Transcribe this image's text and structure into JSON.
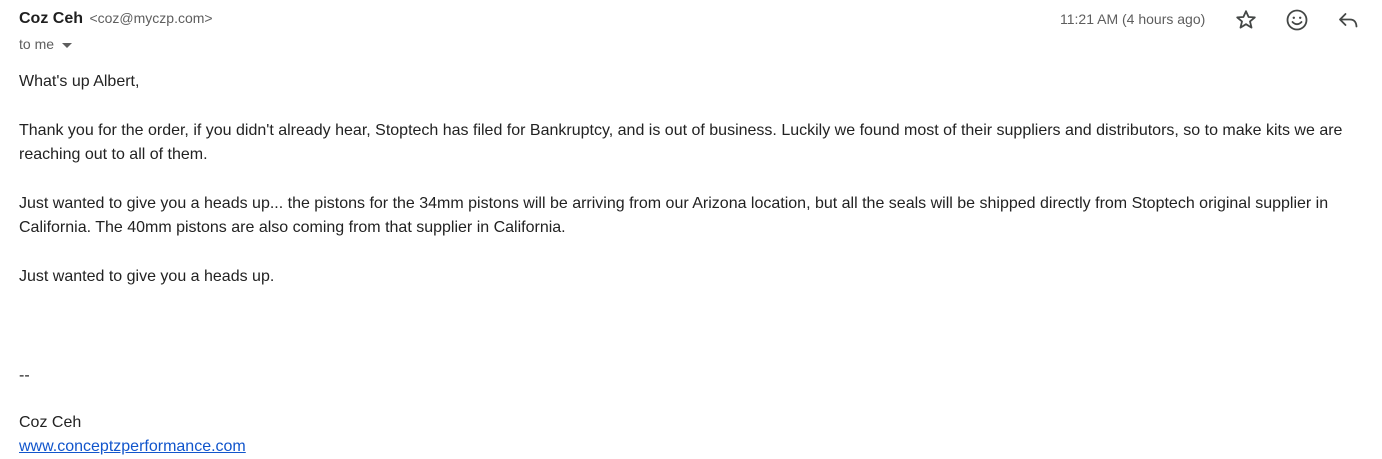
{
  "header": {
    "sender_name": "Coz Ceh",
    "sender_email": "<coz@myczp.com>",
    "recipient_label": "to me",
    "timestamp": "11:21 AM (4 hours ago)",
    "icons": {
      "star": "star-icon",
      "emoji": "emoji-reaction-icon",
      "reply": "reply-icon"
    }
  },
  "body": {
    "greeting": "What's up Albert,",
    "paragraph_1": "Thank you for the order, if you didn't already hear, Stoptech has filed for Bankruptcy, and is out of business.  Luckily we found most of their suppliers and distributors, so to make kits we are reaching out to all of them.",
    "paragraph_2": "Just wanted to give you a heads up... the pistons for the 34mm pistons will be arriving from our Arizona location, but all the seals will be shipped directly from Stoptech original supplier in California.  The 40mm pistons are also coming from that supplier in California.",
    "paragraph_3": "Just wanted to give you a heads up.",
    "signature_separator": "--",
    "signature_name": "Coz Ceh",
    "signature_link": "www.conceptzperformance.com"
  },
  "colors": {
    "text": "#222222",
    "muted": "#5e5e5e",
    "link": "#1155cc",
    "background": "#ffffff"
  }
}
